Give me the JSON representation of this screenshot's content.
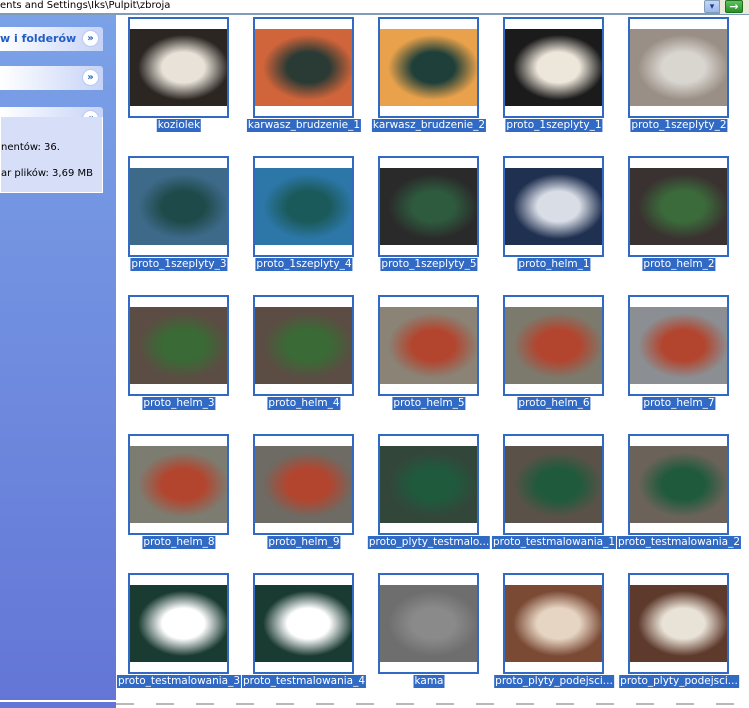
{
  "address": {
    "path": "ents and Settings\\Iks\\Pulpit\\zbroja",
    "dropdown_icon": "chevron-down-icon",
    "go_icon": "arrow-right-icon"
  },
  "taskpane": {
    "panels": [
      {
        "title": "w i folderów",
        "state": "collapsed"
      },
      {
        "title": "",
        "state": "collapsed"
      },
      {
        "title": "",
        "state": "expanded"
      }
    ],
    "details": {
      "line1": "nentów: 36.",
      "line2": "ar plików: 3,69 MB"
    }
  },
  "files": [
    {
      "name": "koziolek",
      "bg": "#2b2622",
      "fg": "#e8e2d8"
    },
    {
      "name": "karwasz_brudzenie_1",
      "bg": "#d0643a",
      "fg": "#2a3a34"
    },
    {
      "name": "karwasz_brudzenie_2",
      "bg": "#e9a24b",
      "fg": "#1e3f3a"
    },
    {
      "name": "proto_1szeplyty_1",
      "bg": "#1b1b1b",
      "fg": "#ede6da"
    },
    {
      "name": "proto_1szeplyty_2",
      "bg": "#9a8f86",
      "fg": "#d9d6d0"
    },
    {
      "name": "proto_1szeplyty_3",
      "bg": "#3e6a8a",
      "fg": "#1f4a4a"
    },
    {
      "name": "proto_1szeplyty_4",
      "bg": "#2c77a8",
      "fg": "#1b5a5a"
    },
    {
      "name": "proto_1szeplyty_5",
      "bg": "#2a2a2a",
      "fg": "#2e5a3e"
    },
    {
      "name": "proto_helm_1",
      "bg": "#203050",
      "fg": "#d8dde6"
    },
    {
      "name": "proto_helm_2",
      "bg": "#3a3230",
      "fg": "#3b6b3b"
    },
    {
      "name": "proto_helm_3",
      "bg": "#5b4d43",
      "fg": "#3a6a35"
    },
    {
      "name": "proto_helm_4",
      "bg": "#5b4d43",
      "fg": "#3a6a35"
    },
    {
      "name": "proto_helm_5",
      "bg": "#8a8376",
      "fg": "#b3452e"
    },
    {
      "name": "proto_helm_6",
      "bg": "#7c7a6d",
      "fg": "#b3452e"
    },
    {
      "name": "proto_helm_7",
      "bg": "#8b8f93",
      "fg": "#b3452e"
    },
    {
      "name": "proto_helm_8",
      "bg": "#7d7c70",
      "fg": "#b3452e"
    },
    {
      "name": "proto_helm_9",
      "bg": "#6d6b63",
      "fg": "#b3452e"
    },
    {
      "name": "proto_plyty_testmalo...",
      "bg": "#33463a",
      "fg": "#1f5a3d"
    },
    {
      "name": "proto_testmalowania_1",
      "bg": "#5a5248",
      "fg": "#1f5a3d"
    },
    {
      "name": "proto_testmalowania_2",
      "bg": "#6b635a",
      "fg": "#1f5a3d"
    },
    {
      "name": "proto_testmalowania_3",
      "bg": "#1a3b32",
      "fg": "#ffffff"
    },
    {
      "name": "proto_testmalowania_4",
      "bg": "#1a3b32",
      "fg": "#ffffff"
    },
    {
      "name": "kama",
      "bg": "#6e6e6e",
      "fg": "#8a8a8a"
    },
    {
      "name": "proto_plyty_podejsci...",
      "bg": "#7a4a35",
      "fg": "#e7d5c3"
    },
    {
      "name": "proto_plyty_podejsci...",
      "bg": "#5e3a2c",
      "fg": "#e9e2d6"
    }
  ],
  "colors": {
    "selection": "#316ac5",
    "pane_top": "#7ba2e7",
    "pane_bottom": "#6375d6"
  }
}
